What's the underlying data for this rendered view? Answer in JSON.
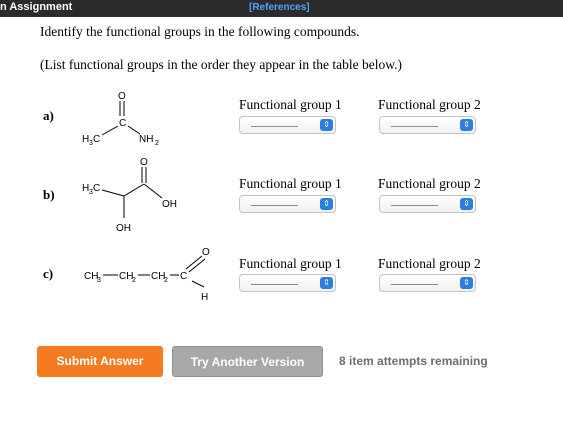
{
  "header": {
    "title": "n Assignment",
    "references": "[References]"
  },
  "question": {
    "prompt": "Identify the functional groups in the following compounds.",
    "instruction": "(List functional groups in the order they appear in the table below.)"
  },
  "rows": [
    {
      "label": "a)",
      "molecule": {
        "atoms": [
          "O",
          "C",
          "H",
          "3",
          "C",
          "NH",
          "2"
        ]
      },
      "group1_label": "Functional group 1",
      "group2_label": "Functional group 2",
      "group1_value": "",
      "group2_value": ""
    },
    {
      "label": "b)",
      "molecule": {
        "atoms": [
          "O",
          "H",
          "3",
          "C",
          "OH",
          "OH"
        ]
      },
      "group1_label": "Functional group 1",
      "group2_label": "Functional group 2",
      "group1_value": "",
      "group2_value": ""
    },
    {
      "label": "c)",
      "molecule": {
        "atoms": [
          "CH",
          "3",
          "CH",
          "2",
          "CH",
          "2",
          "C",
          "O",
          "H"
        ]
      },
      "group1_label": "Functional group 1",
      "group2_label": "Functional group 2",
      "group1_value": "",
      "group2_value": ""
    }
  ],
  "icons": {
    "select_arrow": "updown-chevron-icon"
  },
  "footer": {
    "submit_label": "Submit Answer",
    "try_label": "Try Another Version",
    "attempts_text": "8 item attempts remaining"
  },
  "colors": {
    "submit": "#f47b20",
    "try_another": "#a8a8a8",
    "select_arrow": "#2b7de0",
    "references_link": "#4fa3ff",
    "topbar": "#2b2b2b"
  }
}
